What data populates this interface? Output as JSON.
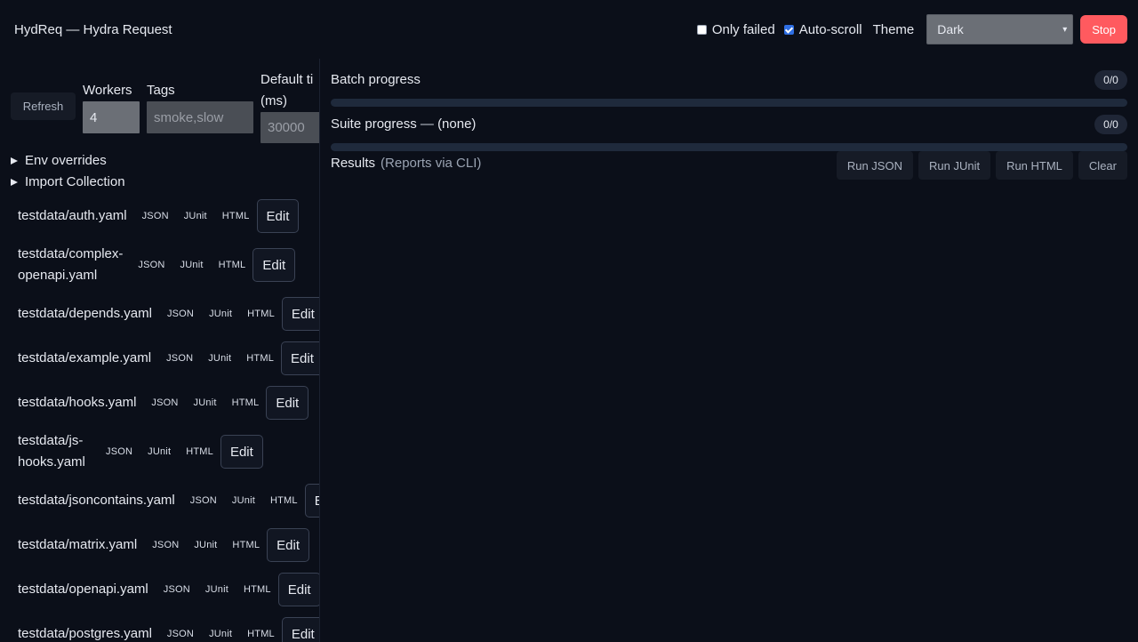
{
  "header": {
    "title": "HydReq — Hydra Request",
    "only_failed_label": "Only failed",
    "only_failed_checked": false,
    "auto_scroll_label": "Auto-scroll",
    "auto_scroll_checked": true,
    "theme_label": "Theme",
    "theme_value": "Dark",
    "stop_label": "Stop"
  },
  "sidebar": {
    "refresh_label": "Refresh",
    "workers_label": "Workers",
    "workers_value": "4",
    "tags_label": "Tags",
    "tags_placeholder": "smoke,slow",
    "timeout_label_line1": "Default ti",
    "timeout_label_line2": "(ms)",
    "timeout_placeholder": "30000",
    "env_overrides_label": "Env overrides",
    "import_collection_label": "Import Collection",
    "formats": {
      "json": "JSON",
      "junit": "JUnit",
      "html": "HTML"
    },
    "edit_label": "Edit",
    "files": [
      {
        "line1": "testdata/auth.yaml",
        "line2": ""
      },
      {
        "line1": "testdata/complex-",
        "line2": "openapi.yaml"
      },
      {
        "line1": "testdata/depends.yaml",
        "line2": ""
      },
      {
        "line1": "testdata/example.yaml",
        "line2": ""
      },
      {
        "line1": "testdata/hooks.yaml",
        "line2": ""
      },
      {
        "line1": "testdata/js-",
        "line2": "hooks.yaml"
      },
      {
        "line1": "testdata/jsoncontains.yaml",
        "line2": ""
      },
      {
        "line1": "testdata/matrix.yaml",
        "line2": ""
      },
      {
        "line1": "testdata/openapi.yaml",
        "line2": ""
      },
      {
        "line1": "testdata/postgres.yaml",
        "line2": ""
      }
    ]
  },
  "main": {
    "batch_label": "Batch progress",
    "batch_count": "0/0",
    "batch_fraction": 0,
    "suite_label": "Suite progress",
    "suite_separator": " — ",
    "suite_name": "(none)",
    "suite_count": "0/0",
    "suite_fraction": 0,
    "results_label": "Results",
    "results_note": "(Reports via CLI)",
    "run_json_label": "Run JSON",
    "run_junit_label": "Run JUnit",
    "run_html_label": "Run HTML",
    "clear_label": "Clear"
  },
  "colors": {
    "background": "#0b0f19",
    "stop_button": "#ff5a5f",
    "checkbox_checked": "#2f6fe4"
  }
}
